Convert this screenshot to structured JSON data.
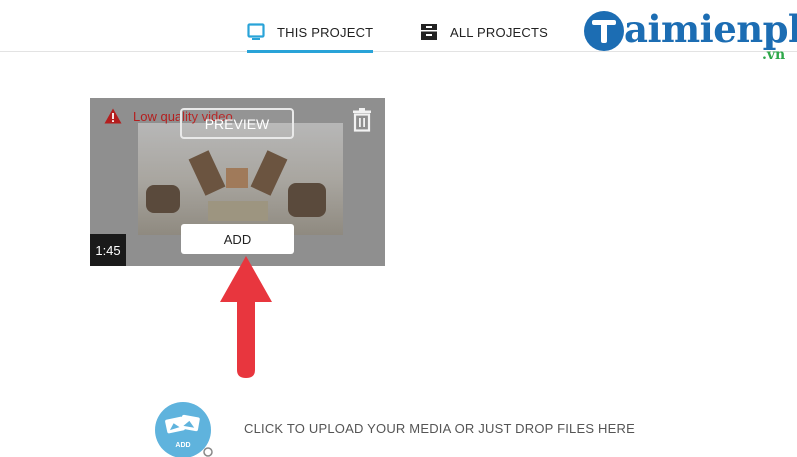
{
  "tabs": {
    "this_project": "THIS PROJECT",
    "all_projects": "ALL PROJECTS",
    "active": "this_project"
  },
  "watermark": {
    "brand": "aimienphi",
    "suffix": ".vn"
  },
  "media": {
    "warning": "Low quality video",
    "preview_label": "PREVIEW",
    "add_label": "ADD",
    "duration": "1:45"
  },
  "upload": {
    "icon_label": "ADD",
    "text": "CLICK TO UPLOAD YOUR MEDIA OR JUST DROP FILES HERE"
  },
  "colors": {
    "accent": "#29a3d8",
    "warning": "#b41e1e",
    "arrow": "#e8363e",
    "brand": "#1c6db3"
  },
  "icons": {
    "this_project": "monitor-icon",
    "all_projects": "archive-box-icon",
    "warning": "warning-triangle-icon",
    "delete": "trash-icon",
    "upload": "image-upload-icon"
  }
}
